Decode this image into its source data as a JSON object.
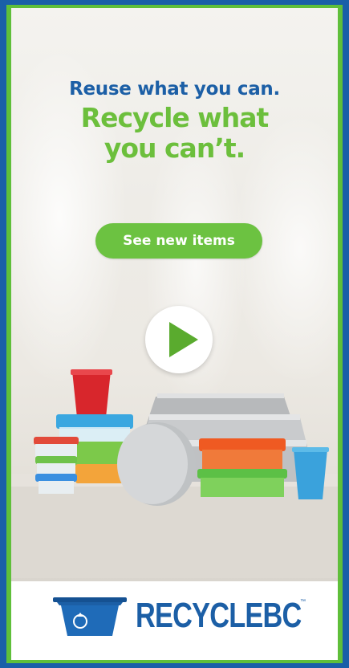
{
  "ad": {
    "headline_line1": "Reuse what you can.",
    "headline_line2a": "Recycle what",
    "headline_line2b": "you can’t.",
    "cta_label": "See new items",
    "play_button": "play-icon",
    "brand_name": "RECYCLEBC",
    "brand_tm": "™"
  },
  "colors": {
    "frame_blue": "#1a5fa8",
    "brand_green": "#6cc241",
    "brand_blue": "#1c5fa6"
  }
}
